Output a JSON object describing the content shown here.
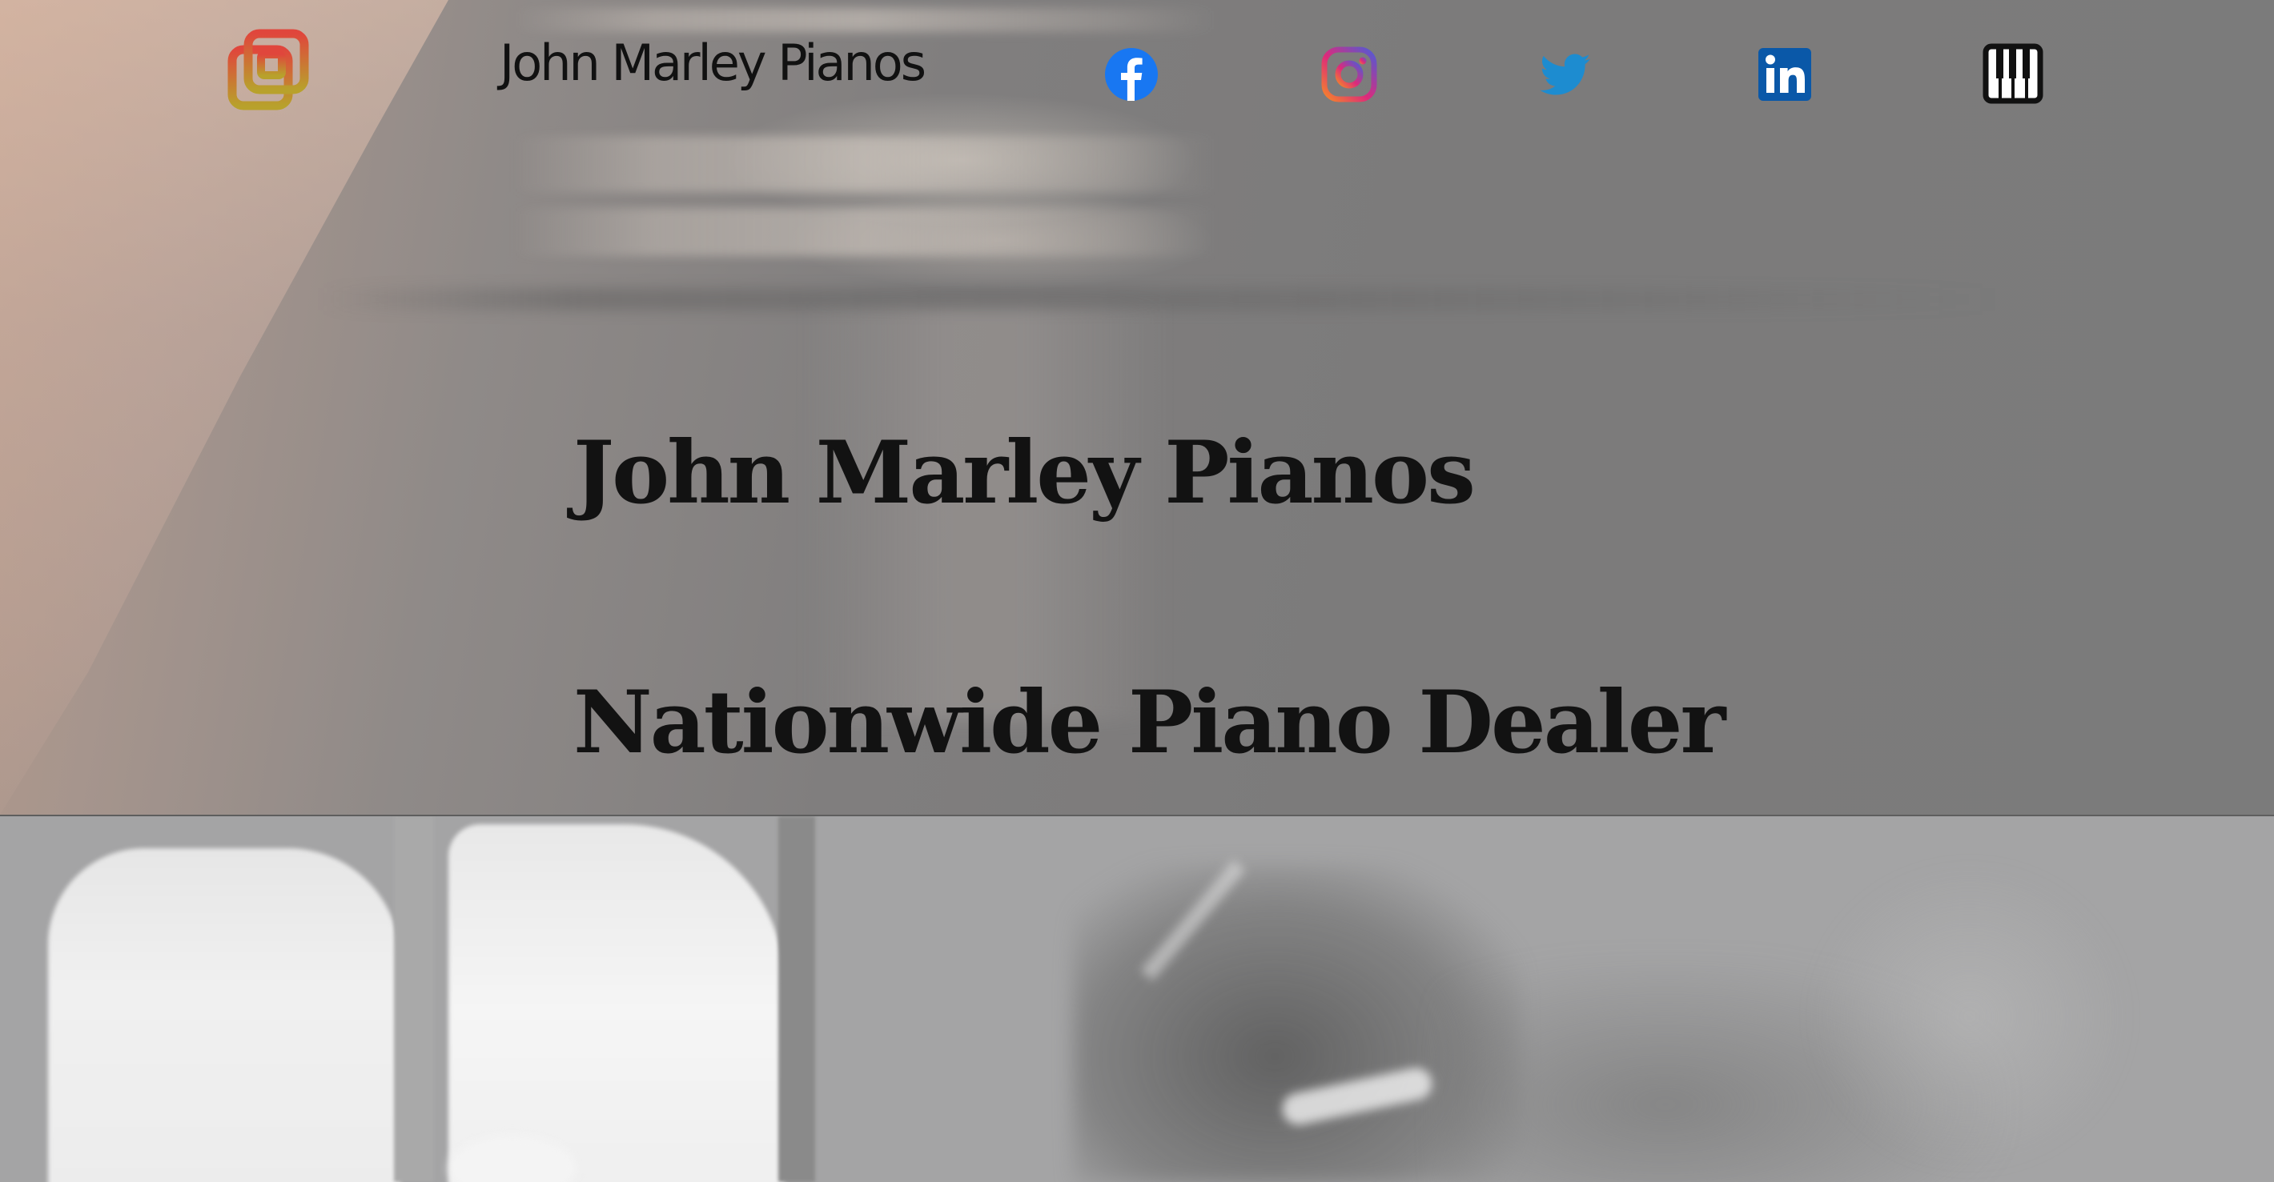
{
  "header": {
    "site_name": "John Marley Pianos",
    "logo_icon": "logo-icon",
    "social": [
      {
        "name": "facebook-icon",
        "color": "#1877F2"
      },
      {
        "name": "instagram-icon",
        "color": "#C13584"
      },
      {
        "name": "twitter-icon",
        "color": "#1DA1F2"
      },
      {
        "name": "linkedin-icon",
        "color": "#0A66C2"
      },
      {
        "name": "piano-keys-icon",
        "color": "#111111"
      }
    ]
  },
  "hero": {
    "title": "John Marley Pianos",
    "subtitle": "Nationwide Piano Dealer"
  },
  "colors": {
    "logo_gradient_start": "#E0463C",
    "logo_gradient_end": "#B8A12C",
    "heading_text": "#121212"
  }
}
